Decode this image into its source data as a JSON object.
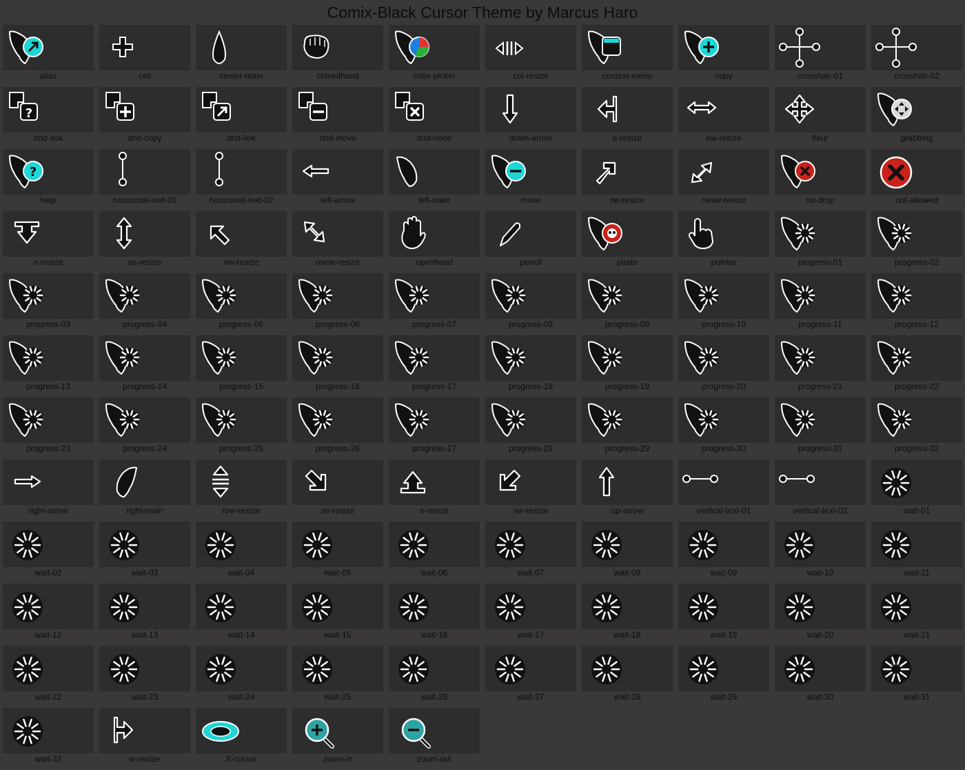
{
  "title": "Comix-Black Cursor Theme by Marcus Haro",
  "cursors": [
    {
      "name": "alias",
      "icon": "alias-icon"
    },
    {
      "name": "cell",
      "icon": "cell-icon"
    },
    {
      "name": "center-main",
      "icon": "center-main-icon"
    },
    {
      "name": "closedhand",
      "icon": "closedhand-icon"
    },
    {
      "name": "color-picker",
      "icon": "color-picker-icon"
    },
    {
      "name": "col-resize",
      "icon": "col-resize-icon"
    },
    {
      "name": "context-menu",
      "icon": "context-menu-icon"
    },
    {
      "name": "copy",
      "icon": "copy-icon"
    },
    {
      "name": "crosshair-01",
      "icon": "crosshair-icon"
    },
    {
      "name": "crosshair-02",
      "icon": "crosshair-icon"
    },
    {
      "name": "dnd-ask",
      "icon": "dnd-ask-icon"
    },
    {
      "name": "dnd-copy",
      "icon": "dnd-copy-icon"
    },
    {
      "name": "dnd-link",
      "icon": "dnd-link-icon"
    },
    {
      "name": "dnd-move",
      "icon": "dnd-move-icon"
    },
    {
      "name": "dnd-none",
      "icon": "dnd-none-icon"
    },
    {
      "name": "down-arrow",
      "icon": "down-arrow-icon"
    },
    {
      "name": "e-resize",
      "icon": "e-resize-icon"
    },
    {
      "name": "ew-resize",
      "icon": "ew-resize-icon"
    },
    {
      "name": "fleur",
      "icon": "fleur-icon"
    },
    {
      "name": "grabbing",
      "icon": "grabbing-icon"
    },
    {
      "name": "help",
      "icon": "help-icon"
    },
    {
      "name": "horizontal-text-01",
      "icon": "horizontal-text-icon"
    },
    {
      "name": "horizontal-text-02",
      "icon": "horizontal-text-icon"
    },
    {
      "name": "left-arrow",
      "icon": "left-arrow-icon"
    },
    {
      "name": "left-main",
      "icon": "left-main-icon"
    },
    {
      "name": "move",
      "icon": "move-icon"
    },
    {
      "name": "ne-resize",
      "icon": "ne-resize-icon"
    },
    {
      "name": "nesw-resize",
      "icon": "nesw-resize-icon"
    },
    {
      "name": "no-drop",
      "icon": "no-drop-icon"
    },
    {
      "name": "not-allowed",
      "icon": "not-allowed-icon"
    },
    {
      "name": "n-resize",
      "icon": "n-resize-icon"
    },
    {
      "name": "ns-resize",
      "icon": "ns-resize-icon"
    },
    {
      "name": "nw-resize",
      "icon": "nw-resize-icon"
    },
    {
      "name": "nwse-resize",
      "icon": "nwse-resize-icon"
    },
    {
      "name": "openhand",
      "icon": "openhand-icon"
    },
    {
      "name": "pencil",
      "icon": "pencil-icon"
    },
    {
      "name": "pirate",
      "icon": "pirate-icon"
    },
    {
      "name": "pointer",
      "icon": "pointer-icon"
    },
    {
      "name": "progress-01",
      "icon": "progress-icon"
    },
    {
      "name": "progress-02",
      "icon": "progress-icon"
    },
    {
      "name": "progress-03",
      "icon": "progress-icon"
    },
    {
      "name": "progress-04",
      "icon": "progress-icon"
    },
    {
      "name": "progress-05",
      "icon": "progress-icon"
    },
    {
      "name": "progress-06",
      "icon": "progress-icon"
    },
    {
      "name": "progress-07",
      "icon": "progress-icon"
    },
    {
      "name": "progress-08",
      "icon": "progress-icon"
    },
    {
      "name": "progress-09",
      "icon": "progress-icon"
    },
    {
      "name": "progress-10",
      "icon": "progress-icon"
    },
    {
      "name": "progress-11",
      "icon": "progress-icon"
    },
    {
      "name": "progress-12",
      "icon": "progress-icon"
    },
    {
      "name": "progress-13",
      "icon": "progress-icon"
    },
    {
      "name": "progress-14",
      "icon": "progress-icon"
    },
    {
      "name": "progress-15",
      "icon": "progress-icon"
    },
    {
      "name": "progress-16",
      "icon": "progress-icon"
    },
    {
      "name": "progress-17",
      "icon": "progress-icon"
    },
    {
      "name": "progress-18",
      "icon": "progress-icon"
    },
    {
      "name": "progress-19",
      "icon": "progress-icon"
    },
    {
      "name": "progress-20",
      "icon": "progress-icon"
    },
    {
      "name": "progress-21",
      "icon": "progress-icon"
    },
    {
      "name": "progress-22",
      "icon": "progress-icon"
    },
    {
      "name": "progress-23",
      "icon": "progress-icon"
    },
    {
      "name": "progress-24",
      "icon": "progress-icon"
    },
    {
      "name": "progress-25",
      "icon": "progress-icon"
    },
    {
      "name": "progress-26",
      "icon": "progress-icon"
    },
    {
      "name": "progress-27",
      "icon": "progress-icon"
    },
    {
      "name": "progress-28",
      "icon": "progress-icon"
    },
    {
      "name": "progress-29",
      "icon": "progress-icon"
    },
    {
      "name": "progress-30",
      "icon": "progress-icon"
    },
    {
      "name": "progress-31",
      "icon": "progress-icon"
    },
    {
      "name": "progress-32",
      "icon": "progress-icon"
    },
    {
      "name": "right-arrow",
      "icon": "right-arrow-icon"
    },
    {
      "name": "right-main",
      "icon": "right-main-icon"
    },
    {
      "name": "row-resize",
      "icon": "row-resize-icon"
    },
    {
      "name": "se-resize",
      "icon": "se-resize-icon"
    },
    {
      "name": "s-resize",
      "icon": "s-resize-icon"
    },
    {
      "name": "sw-resize",
      "icon": "sw-resize-icon"
    },
    {
      "name": "up-arrow",
      "icon": "up-arrow-icon"
    },
    {
      "name": "vertical-text-01",
      "icon": "vertical-text-icon"
    },
    {
      "name": "vertical-text-02",
      "icon": "vertical-text-icon"
    },
    {
      "name": "wait-01",
      "icon": "wait-icon"
    },
    {
      "name": "wait-02",
      "icon": "wait-icon"
    },
    {
      "name": "wait-03",
      "icon": "wait-icon"
    },
    {
      "name": "wait-04",
      "icon": "wait-icon"
    },
    {
      "name": "wait-05",
      "icon": "wait-icon"
    },
    {
      "name": "wait-06",
      "icon": "wait-icon"
    },
    {
      "name": "wait-07",
      "icon": "wait-icon"
    },
    {
      "name": "wait-08",
      "icon": "wait-icon"
    },
    {
      "name": "wait-09",
      "icon": "wait-icon"
    },
    {
      "name": "wait-10",
      "icon": "wait-icon"
    },
    {
      "name": "wait-11",
      "icon": "wait-icon"
    },
    {
      "name": "wait-12",
      "icon": "wait-icon"
    },
    {
      "name": "wait-13",
      "icon": "wait-icon"
    },
    {
      "name": "wait-14",
      "icon": "wait-icon"
    },
    {
      "name": "wait-15",
      "icon": "wait-icon"
    },
    {
      "name": "wait-16",
      "icon": "wait-icon"
    },
    {
      "name": "wait-17",
      "icon": "wait-icon"
    },
    {
      "name": "wait-18",
      "icon": "wait-icon"
    },
    {
      "name": "wait-19",
      "icon": "wait-icon"
    },
    {
      "name": "wait-20",
      "icon": "wait-icon"
    },
    {
      "name": "wait-21",
      "icon": "wait-icon"
    },
    {
      "name": "wait-22",
      "icon": "wait-icon"
    },
    {
      "name": "wait-23",
      "icon": "wait-icon"
    },
    {
      "name": "wait-24",
      "icon": "wait-icon"
    },
    {
      "name": "wait-25",
      "icon": "wait-icon"
    },
    {
      "name": "wait-26",
      "icon": "wait-icon"
    },
    {
      "name": "wait-27",
      "icon": "wait-icon"
    },
    {
      "name": "wait-28",
      "icon": "wait-icon"
    },
    {
      "name": "wait-29",
      "icon": "wait-icon"
    },
    {
      "name": "wait-30",
      "icon": "wait-icon"
    },
    {
      "name": "wait-31",
      "icon": "wait-icon"
    },
    {
      "name": "wait-32",
      "icon": "wait-icon"
    },
    {
      "name": "w-resize",
      "icon": "w-resize-icon"
    },
    {
      "name": "X-cursor",
      "icon": "x-cursor-icon"
    },
    {
      "name": "zoom-in",
      "icon": "zoom-in-icon"
    },
    {
      "name": "zoom-out",
      "icon": "zoom-out-icon"
    }
  ],
  "colors": {
    "background": "#3a3937",
    "tile": "#2d2d2d",
    "accent": "#1ed6d6",
    "danger": "#c8221a",
    "label": "#0b0b0b"
  }
}
